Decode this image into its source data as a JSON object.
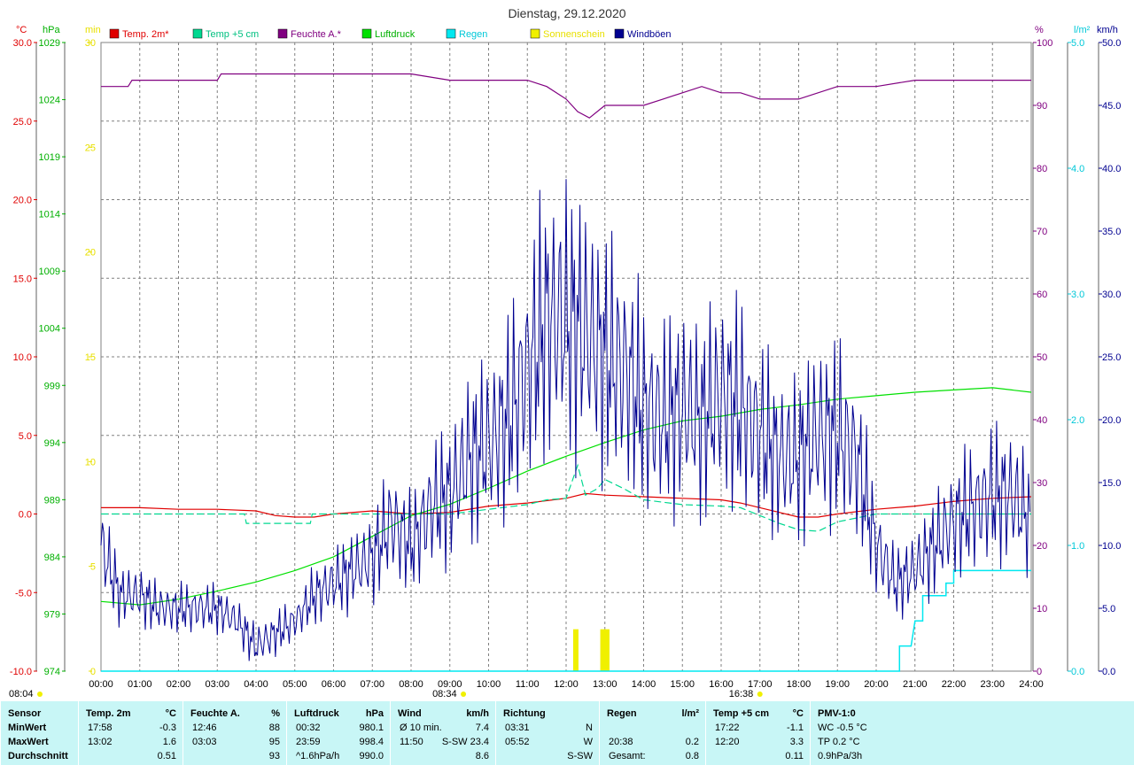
{
  "title": "Dienstag, 29.12.2020",
  "colors": {
    "temp": "#e00000",
    "temp5": "#00d890",
    "hum": "#800080",
    "press": "#00e000",
    "rain": "#00e8f0",
    "sun": "#f0f000",
    "gust": "#000090",
    "grid": "#808080",
    "status_bg": "#c8f6f6"
  },
  "legend": [
    {
      "label": "Temp. 2m*",
      "color": "#e00000",
      "text_color": "#e00000"
    },
    {
      "label": "Temp +5 cm",
      "color": "#00d890",
      "text_color": "#00c080"
    },
    {
      "label": "Feuchte A.*",
      "color": "#800080",
      "text_color": "#800080"
    },
    {
      "label": "Luftdruck",
      "color": "#00e000",
      "text_color": "#00b000"
    },
    {
      "label": "Regen",
      "color": "#00e8f0",
      "text_color": "#00c8d8"
    },
    {
      "label": "Sonnenschein",
      "color": "#f0f000",
      "text_color": "#e8e000"
    },
    {
      "label": "Windböen",
      "color": "#000090",
      "text_color": "#000090"
    }
  ],
  "axis_units": {
    "temp": "°C",
    "press": "hPa",
    "sun": "min",
    "hum": "%",
    "rain": "l/m²",
    "wind": "km/h"
  },
  "chart_data": {
    "type": "line",
    "title": "Dienstag, 29.12.2020",
    "x_ticks": [
      "00:00",
      "01:00",
      "02:00",
      "03:00",
      "04:00",
      "05:00",
      "06:00",
      "07:00",
      "08:00",
      "09:00",
      "10:00",
      "11:00",
      "12:00",
      "13:00",
      "14:00",
      "15:00",
      "16:00",
      "17:00",
      "18:00",
      "19:00",
      "20:00",
      "21:00",
      "22:00",
      "23:00",
      "24:00"
    ],
    "axes": {
      "temp": {
        "range": [
          -10,
          30
        ],
        "ticks": [
          "30.0",
          "25.0",
          "20.0",
          "15.0",
          "10.0",
          "5.0",
          "0.0",
          "-5.0",
          "-10.0"
        ]
      },
      "press": {
        "range": [
          974,
          1029
        ],
        "ticks": [
          "1029",
          "1024",
          "1019",
          "1014",
          "1009",
          "1004",
          "999",
          "994",
          "989",
          "984",
          "979",
          "974"
        ]
      },
      "sun": {
        "range": [
          0,
          30
        ],
        "ticks": [
          "30",
          "25",
          "20",
          "15",
          "10",
          "5",
          "0"
        ]
      },
      "hum": {
        "range": [
          0,
          100
        ],
        "ticks": [
          "100",
          "90",
          "80",
          "70",
          "60",
          "50",
          "40",
          "30",
          "20",
          "10",
          "0"
        ]
      },
      "rain": {
        "range": [
          0,
          5
        ],
        "ticks": [
          "5.0",
          "4.0",
          "3.0",
          "2.0",
          "1.0",
          "0.0"
        ]
      },
      "wind": {
        "range": [
          0,
          50
        ],
        "ticks": [
          "50.0",
          "45.0",
          "40.0",
          "35.0",
          "30.0",
          "25.0",
          "20.0",
          "15.0",
          "10.0",
          "5.0",
          "0.0"
        ]
      }
    },
    "grid": true,
    "series": [
      {
        "name": "Temp. 2m*",
        "axis": "temp",
        "hours": [
          0,
          1,
          2,
          3,
          4,
          4.5,
          5,
          5.5,
          6,
          7,
          8,
          9,
          10,
          11,
          12,
          12.5,
          13,
          14,
          15,
          16,
          16.5,
          17,
          17.5,
          18,
          18.5,
          19,
          20,
          21,
          22,
          22.5,
          23,
          24
        ],
        "values": [
          0.4,
          0.4,
          0.3,
          0.3,
          0.2,
          -0.1,
          -0.2,
          -0.2,
          0.0,
          0.2,
          0.0,
          0.1,
          0.5,
          0.7,
          1.0,
          1.3,
          1.2,
          1.1,
          1.0,
          0.9,
          0.7,
          0.4,
          0.1,
          -0.2,
          -0.2,
          0.0,
          0.3,
          0.5,
          0.8,
          0.9,
          1.0,
          1.1
        ]
      },
      {
        "name": "Temp +5 cm",
        "axis": "temp",
        "hours": [
          0,
          3,
          3.7,
          3.75,
          5.4,
          5.45,
          6,
          8,
          9,
          10,
          11,
          11.5,
          12,
          12.3,
          12.5,
          12.8,
          13,
          13.5,
          14,
          15,
          16,
          16.5,
          17,
          17.5,
          18,
          18.5,
          19,
          20,
          21,
          22,
          23,
          24
        ],
        "values": [
          0.0,
          0.0,
          0.0,
          -0.6,
          -0.6,
          0.0,
          0.0,
          0.0,
          0.0,
          0.3,
          0.6,
          0.9,
          1.0,
          3.1,
          1.2,
          1.6,
          2.2,
          1.6,
          0.9,
          0.6,
          0.5,
          0.4,
          -0.1,
          -0.6,
          -1.0,
          -1.1,
          -0.5,
          0.0,
          0.0,
          0.0,
          0.0,
          0.0
        ]
      },
      {
        "name": "Feuchte A.*",
        "axis": "hum",
        "hours": [
          0,
          0.7,
          0.8,
          3,
          3.1,
          4,
          5,
          8,
          9,
          11,
          11.5,
          12,
          12.3,
          12.6,
          13,
          14,
          14.5,
          15,
          15.5,
          16,
          16.5,
          17,
          18,
          19,
          20,
          21,
          22,
          23,
          24
        ],
        "values": [
          93,
          93,
          94,
          94,
          95,
          95,
          95,
          95,
          94,
          94,
          93,
          91,
          89,
          88,
          90,
          90,
          91,
          92,
          93,
          92,
          92,
          91,
          91,
          93,
          93,
          94,
          94,
          94,
          94
        ]
      },
      {
        "name": "Luftdruck",
        "axis": "press",
        "hours": [
          0,
          1,
          2,
          3,
          4,
          5,
          6,
          7,
          8,
          9,
          10,
          11,
          12,
          13,
          14,
          15,
          16,
          17,
          18,
          19,
          20,
          21,
          22,
          23,
          24
        ],
        "values": [
          980.1,
          979.8,
          980.3,
          981.0,
          981.8,
          982.8,
          984.0,
          985.8,
          987.6,
          988.6,
          990.0,
          991.5,
          992.8,
          994.0,
          995.1,
          995.9,
          996.3,
          996.9,
          997.3,
          997.8,
          998.1,
          998.4,
          998.6,
          998.8,
          998.4
        ]
      },
      {
        "name": "Regen",
        "axis": "rain",
        "hours": [
          0,
          20.6,
          20.6,
          20.9,
          20.9,
          21.0,
          21.0,
          21.2,
          21.2,
          21.5,
          21.5,
          21.8,
          21.8,
          22.0,
          22.0,
          22.1,
          22.1,
          24
        ],
        "values": [
          0,
          0,
          0.2,
          0.2,
          0.2,
          0.4,
          0.4,
          0.4,
          0.6,
          0.6,
          0.6,
          0.6,
          0.7,
          0.7,
          0.8,
          0.8,
          0.8,
          0.8
        ]
      },
      {
        "name": "Windböen",
        "axis": "wind",
        "hours": [
          0,
          0.5,
          1,
          1.5,
          2,
          2.5,
          3,
          3.5,
          4,
          4.5,
          5,
          5.5,
          6,
          6.5,
          7,
          7.5,
          8,
          8.5,
          9,
          9.5,
          10,
          10.5,
          11,
          11.5,
          12,
          12.5,
          13,
          13.5,
          14,
          14.5,
          15,
          15.5,
          16,
          16.5,
          17,
          17.5,
          18,
          18.5,
          19,
          19.5,
          20,
          20.5,
          21,
          21.5,
          22,
          22.5,
          23,
          23.5,
          24
        ],
        "values": [
          10,
          6,
          6,
          5,
          5,
          5,
          5,
          4,
          2,
          3,
          4,
          6,
          7,
          8,
          9,
          12,
          10,
          13,
          14,
          17,
          18,
          20,
          24,
          28,
          28,
          27,
          25,
          24,
          21,
          20,
          21,
          20,
          22,
          21,
          19,
          17,
          17,
          19,
          19,
          17,
          10,
          7,
          8,
          10,
          12,
          13,
          14,
          14,
          12
        ]
      }
    ],
    "sunshine_bars": [
      {
        "hour": 12.25,
        "minutes": 2.0
      },
      {
        "hour": 12.95,
        "minutes": 2.0
      },
      {
        "hour": 13.05,
        "minutes": 2.0
      }
    ],
    "sun_markers": [
      {
        "label": "08:04",
        "hour": -0.45,
        "row": "bottom"
      },
      {
        "label": "08:34",
        "hour": 8.55,
        "row": "mid"
      },
      {
        "label": "16:38",
        "hour": 16.2,
        "row": "mid"
      }
    ]
  },
  "stats": {
    "columns": [
      {
        "header": "Sensor",
        "unit": "",
        "rows": [
          "MinWert",
          "MaxWert",
          "Durchschnitt"
        ]
      },
      {
        "header": "Temp. 2m",
        "unit": "°C",
        "rows": [
          [
            "17:58",
            "-0.3"
          ],
          [
            "13:02",
            "1.6"
          ],
          [
            "",
            "0.51"
          ]
        ]
      },
      {
        "header": "Feuchte A.",
        "unit": "%",
        "rows": [
          [
            "12:46",
            "88"
          ],
          [
            "03:03",
            "95"
          ],
          [
            "",
            "93"
          ]
        ]
      },
      {
        "header": "Luftdruck",
        "unit": "hPa",
        "rows": [
          [
            "00:32",
            "980.1"
          ],
          [
            "23:59",
            "998.4"
          ],
          [
            "^1.6hPa/h",
            "990.0"
          ]
        ]
      },
      {
        "header": "Wind",
        "unit": "km/h",
        "rows": [
          [
            "Ø 10 min.",
            "7.4"
          ],
          [
            "11:50",
            "S-SW 23.4"
          ],
          [
            "",
            "8.6"
          ]
        ]
      },
      {
        "header": "Richtung",
        "unit": "",
        "rows": [
          [
            "03:31",
            "N"
          ],
          [
            "05:52",
            "W"
          ],
          [
            "",
            "S-SW"
          ]
        ]
      },
      {
        "header": "Regen",
        "unit": "l/m²",
        "rows": [
          [
            "",
            ""
          ],
          [
            "20:38",
            "0.2"
          ],
          [
            "Gesamt:",
            "0.8"
          ]
        ]
      },
      {
        "header": "Temp +5 cm",
        "unit": "°C",
        "rows": [
          [
            "17:22",
            "-1.1"
          ],
          [
            "12:20",
            "3.3"
          ],
          [
            "",
            "0.11"
          ]
        ]
      },
      {
        "header": "PMV-1:0",
        "unit": "",
        "rows": [
          "WC -0.5 °C",
          "TP 0.2 °C",
          "0.9hPa/3h"
        ]
      }
    ]
  }
}
